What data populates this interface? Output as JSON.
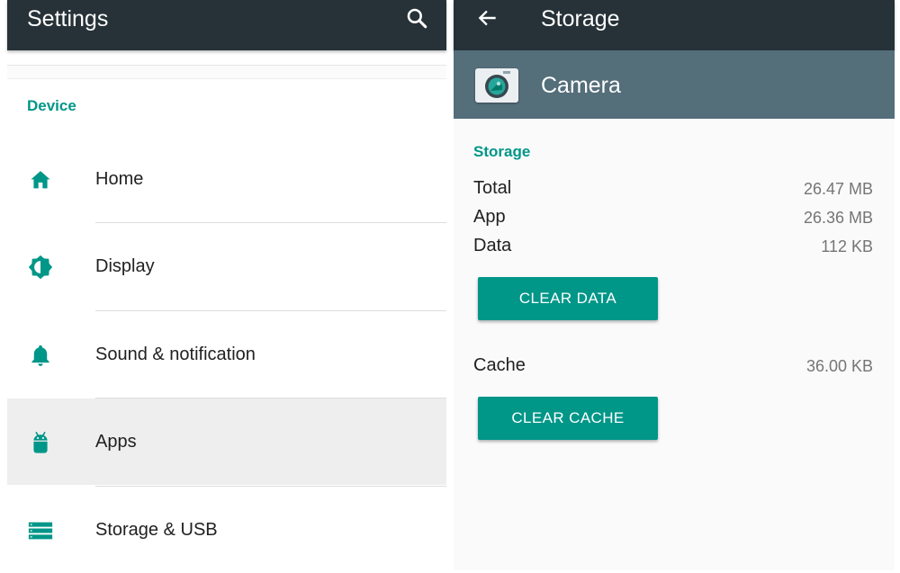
{
  "colors": {
    "appbar": "#263238",
    "accent": "#009688",
    "app_header": "#546e7a",
    "active_row": "#eeeeee"
  },
  "left_panel": {
    "title": "Settings",
    "search_icon": "search-icon",
    "section": "Device",
    "items": [
      {
        "label": "Home",
        "icon": "home-icon"
      },
      {
        "label": "Display",
        "icon": "brightness-icon"
      },
      {
        "label": "Sound & notification",
        "icon": "bell-icon"
      },
      {
        "label": "Apps",
        "icon": "android-icon",
        "active": true
      },
      {
        "label": "Storage & USB",
        "icon": "storage-icon"
      }
    ]
  },
  "right_panel": {
    "title": "Storage",
    "back_icon": "back-arrow-icon",
    "app_name": "Camera",
    "app_icon": "camera-app-icon",
    "section": "Storage",
    "rows": [
      {
        "label": "Total",
        "value": "26.47 MB"
      },
      {
        "label": "App",
        "value": "26.36 MB"
      },
      {
        "label": "Data",
        "value": "112 KB"
      }
    ],
    "clear_data_label": "CLEAR DATA",
    "cache": {
      "label": "Cache",
      "value": "36.00 KB"
    },
    "clear_cache_label": "CLEAR CACHE"
  }
}
